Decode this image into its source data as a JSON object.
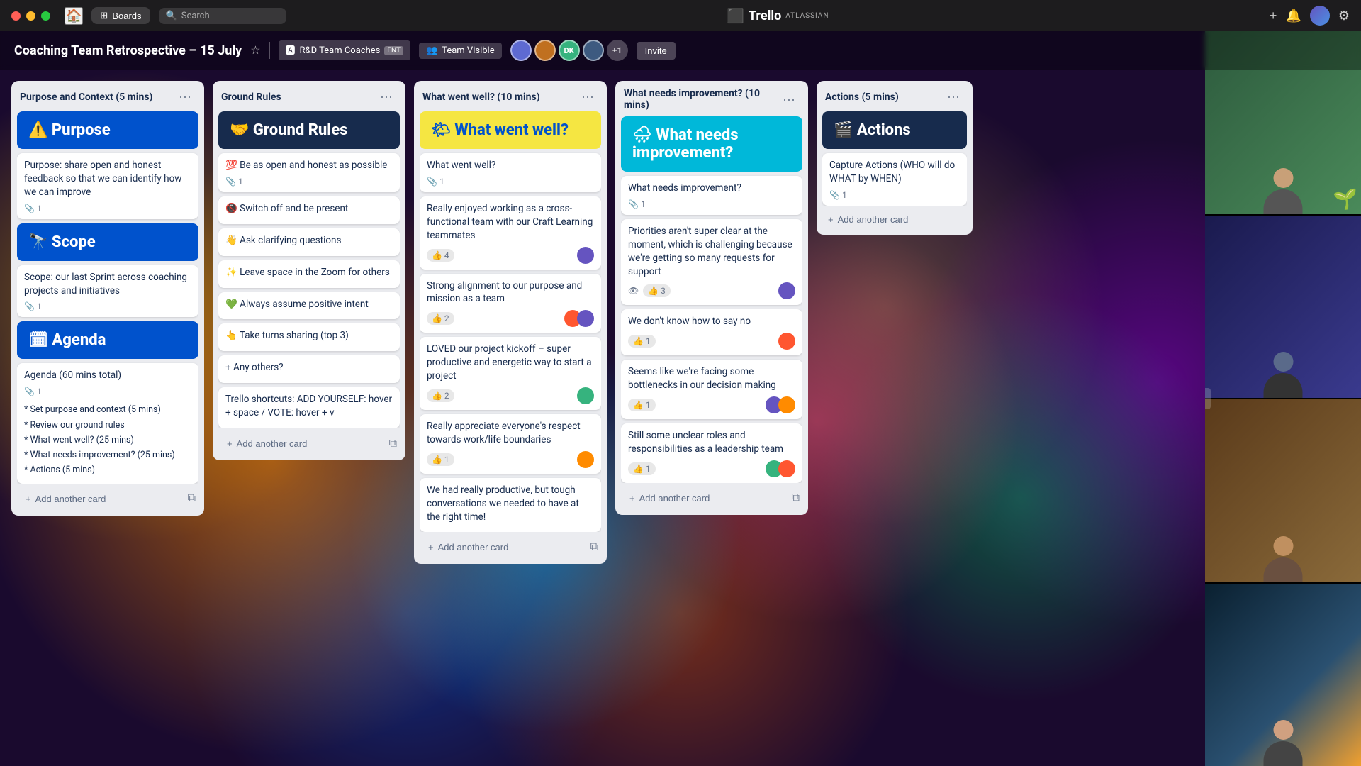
{
  "window": {
    "title": "Trello - Atlassian",
    "traffic_lights": [
      "red",
      "yellow",
      "green"
    ]
  },
  "titlebar": {
    "boards_label": "Boards",
    "search_placeholder": "Search",
    "trello_label": "Trello",
    "atlassian_label": "ATLASSIAN",
    "add_icon": "+",
    "bell_icon": "🔔",
    "settings_icon": "⚙"
  },
  "header": {
    "board_title": "Coaching Team Retrospective – 15 July",
    "star_icon": "☆",
    "workspace_label": "R&D Team Coaches",
    "ent_badge": "ENT",
    "visibility_icon": "👁",
    "visibility_label": "Team Visible",
    "members": [
      {
        "color": "#6554c0",
        "initial": ""
      },
      {
        "color": "#ff5630",
        "initial": ""
      },
      {
        "color": "#36b37e",
        "initial": "DK"
      },
      {
        "color": "#ff8b00",
        "initial": ""
      }
    ],
    "plus_count": "+1",
    "invite_label": "Invite"
  },
  "columns": [
    {
      "id": "purpose",
      "title": "Purpose and Context (5 mins)",
      "cards": [
        {
          "type": "header-blue",
          "emoji": "⚠️",
          "title": "Purpose"
        },
        {
          "type": "normal",
          "text": "Purpose: share open and honest feedback so that we can identify how we can improve",
          "attachments": 1
        },
        {
          "type": "header-blue",
          "emoji": "🔭",
          "title": "Scope"
        },
        {
          "type": "normal",
          "text": "Scope: our last Sprint across coaching projects and initiatives",
          "attachments": 1
        },
        {
          "type": "header-blue",
          "emoji": "🗓",
          "title": "Agenda"
        },
        {
          "type": "normal",
          "text": "Agenda (60 mins total)",
          "attachments": 1,
          "extra_lines": [
            "* Set purpose and context (5 mins)",
            "* Review our ground rules",
            "* What went well? (25 mins)",
            "* What needs improvement? (25 mins)",
            "* Actions (5 mins)"
          ]
        }
      ],
      "add_card_label": "+ Add another card"
    },
    {
      "id": "ground-rules",
      "title": "Ground Rules",
      "cards": [
        {
          "type": "header-dark",
          "emoji": "🤝",
          "title": "Ground Rules"
        },
        {
          "type": "rule",
          "emoji": "💯",
          "text": "Be as open and honest as possible",
          "attachments": 1
        },
        {
          "type": "rule",
          "emoji": "📵",
          "text": "Switch off and be present"
        },
        {
          "type": "rule",
          "emoji": "👋",
          "text": "Ask clarifying questions"
        },
        {
          "type": "rule",
          "emoji": "✨",
          "text": "Leave space in the Zoom for others"
        },
        {
          "type": "rule",
          "emoji": "💚",
          "text": "Always assume positive intent"
        },
        {
          "type": "rule",
          "emoji": "👆",
          "text": "Take turns sharing (top 3)"
        },
        {
          "type": "normal",
          "text": "+ Any others?"
        },
        {
          "type": "normal",
          "text": "Trello shortcuts: ADD YOURSELF: hover + space / VOTE: hover + v"
        }
      ],
      "add_card_label": "+ Add another card"
    },
    {
      "id": "went-well",
      "title": "What went well? (10 mins)",
      "cards": [
        {
          "type": "header-yellow",
          "emoji": "🌤",
          "title": "What went well?"
        },
        {
          "type": "normal",
          "text": "What went well?",
          "attachments": 1
        },
        {
          "type": "normal",
          "text": "Really enjoyed working as a cross-functional team with our Craft Learning teammates",
          "votes": 4,
          "avatars": [
            {
              "color": "#6554c0"
            }
          ]
        },
        {
          "type": "normal",
          "text": "Strong alignment to our purpose and mission as a team",
          "votes": 2,
          "avatars": [
            {
              "color": "#ff5630"
            },
            {
              "color": "#6554c0"
            }
          ]
        },
        {
          "type": "normal",
          "text": "LOVED our project kickoff – super productive and energetic way to start a project",
          "votes": 2,
          "avatars": [
            {
              "color": "#36b37e"
            }
          ]
        },
        {
          "type": "normal",
          "text": "Really appreciate everyone's respect towards work/life boundaries",
          "votes": 1,
          "avatars": [
            {
              "color": "#ff8b00"
            }
          ]
        },
        {
          "type": "normal",
          "text": "We had really productive, but tough conversations we needed to have at the right time!"
        }
      ],
      "add_card_label": "+ Add another card"
    },
    {
      "id": "needs-improvement",
      "title": "What needs improvement? (10 mins)",
      "cards": [
        {
          "type": "header-teal",
          "emoji": "🌧",
          "title": "What needs improvement?"
        },
        {
          "type": "normal",
          "text": "What needs improvement?",
          "attachments": 1
        },
        {
          "type": "normal",
          "text": "Priorities aren't super clear at the moment, which is challenging because we're getting so many requests for support",
          "eye": true,
          "votes": 3,
          "avatars": [
            {
              "color": "#6554c0"
            }
          ]
        },
        {
          "type": "normal",
          "text": "We don't know how to say no",
          "votes": 1,
          "avatars": [
            {
              "color": "#ff5630"
            }
          ]
        },
        {
          "type": "normal",
          "text": "Seems like we're facing some bottlenecks in our decision making",
          "votes": 1,
          "avatars": [
            {
              "color": "#6554c0"
            },
            {
              "color": "#ff8b00"
            }
          ]
        },
        {
          "type": "normal",
          "text": "Still some unclear roles and responsibilities as a leadership team",
          "votes": 1,
          "avatars": [
            {
              "color": "#36b37e"
            },
            {
              "color": "#ff5630"
            }
          ]
        }
      ],
      "add_card_label": "+ Add another card"
    },
    {
      "id": "actions",
      "title": "Actions (5 mins)",
      "cards": [
        {
          "type": "header-navy",
          "emoji": "🎬",
          "title": "Actions"
        },
        {
          "type": "normal",
          "text": "Capture Actions (WHO will do WHAT by WHEN)",
          "attachments": 1
        }
      ],
      "add_card_label": "+ Add another card"
    }
  ],
  "video_panel": {
    "tiles": [
      {
        "bg": "vt1",
        "has_plant": true
      },
      {
        "bg": "vt2"
      },
      {
        "bg": "vt3"
      },
      {
        "bg": "vt4"
      }
    ]
  }
}
